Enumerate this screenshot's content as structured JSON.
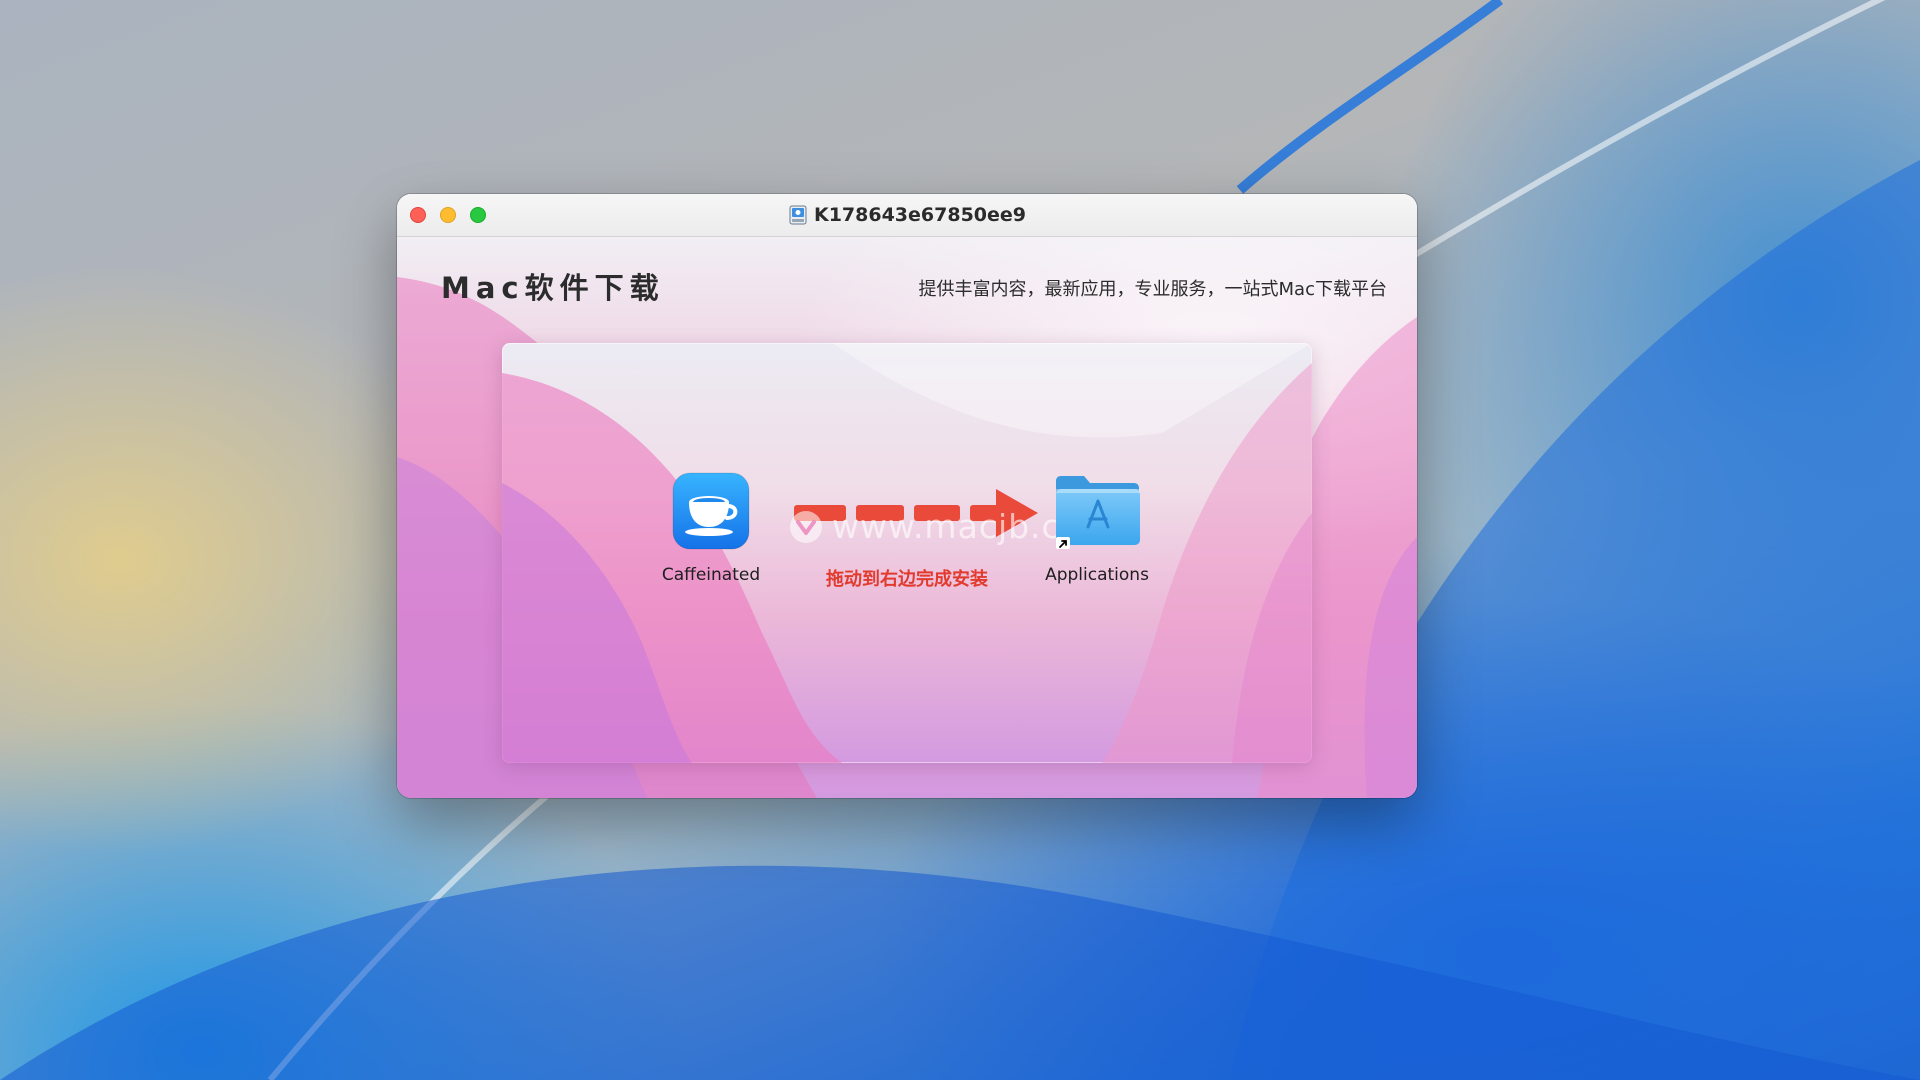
{
  "window": {
    "title": "K178643e67850ee9"
  },
  "header": {
    "brand": "Mac软件下载",
    "slogan": "提供丰富内容，最新应用，专业服务，一站式Mac下载平台"
  },
  "installer": {
    "source_app_label": "Caffeinated",
    "target_label": "Applications",
    "instruction": "拖动到右边完成安装",
    "watermark": "www.macjb.com"
  },
  "colors": {
    "close": "#fe5f57",
    "minimize": "#febc2e",
    "maximize": "#28c840",
    "arrow": "#e94a3a",
    "instruction_text": "#e23b2e"
  },
  "icons": {
    "disk": "disk-image-icon",
    "source_app": "coffee-cup-icon",
    "target": "applications-folder-icon"
  }
}
